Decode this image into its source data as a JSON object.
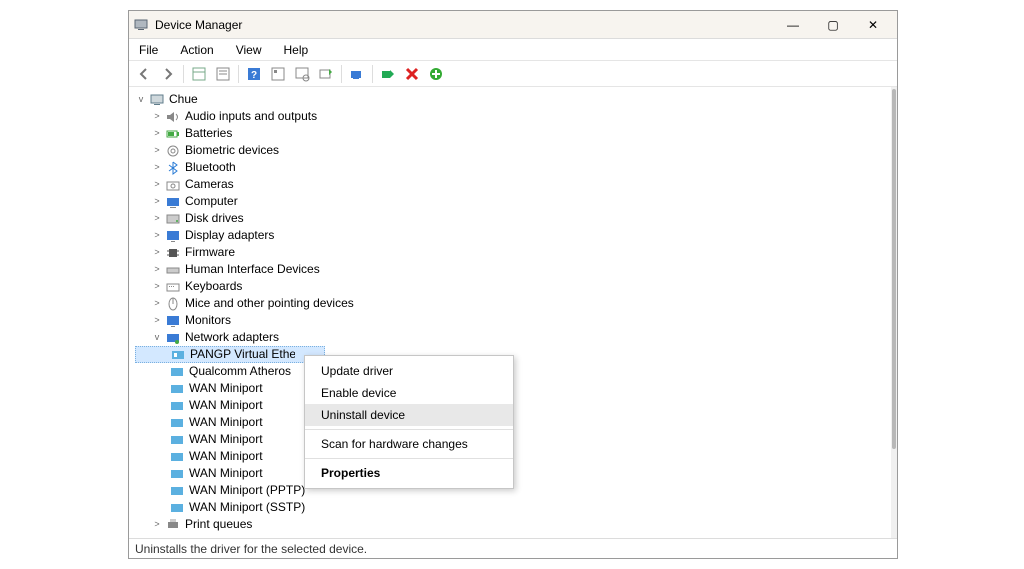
{
  "window": {
    "title": "Device Manager"
  },
  "menubar": {
    "file": "File",
    "action": "Action",
    "view": "View",
    "help": "Help"
  },
  "tree": {
    "root": "Chue",
    "items": [
      "Audio inputs and outputs",
      "Batteries",
      "Biometric devices",
      "Bluetooth",
      "Cameras",
      "Computer",
      "Disk drives",
      "Display adapters",
      "Firmware",
      "Human Interface Devices",
      "Keyboards",
      "Mice and other pointing devices",
      "Monitors"
    ],
    "network_label": "Network adapters",
    "adapters": [
      "PANGP Virtual Ethernet Adapter",
      "Qualcomm Atheros",
      "WAN Miniport",
      "WAN Miniport",
      "WAN Miniport",
      "WAN Miniport",
      "WAN Miniport",
      "WAN Miniport",
      "WAN Miniport (PPTP)",
      "WAN Miniport (SSTP)"
    ],
    "print_queues": "Print queues"
  },
  "context": {
    "update": "Update driver",
    "enable": "Enable device",
    "uninstall": "Uninstall device",
    "scan": "Scan for hardware changes",
    "properties": "Properties"
  },
  "statusbar": {
    "text": "Uninstalls the driver for the selected device."
  },
  "icons": {
    "computer": "computer-icon",
    "audio": "speaker-icon",
    "batteries": "battery-icon",
    "biometric": "fingerprint-icon",
    "bluetooth": "bluetooth-icon",
    "cameras": "camera-icon",
    "disk": "disk-icon",
    "display": "display-icon",
    "firmware": "chip-icon",
    "hid": "hid-icon",
    "keyboards": "keyboard-icon",
    "mice": "mouse-icon",
    "monitors": "monitor-icon",
    "network": "network-icon",
    "adapter": "nic-icon",
    "printer": "printer-icon"
  }
}
